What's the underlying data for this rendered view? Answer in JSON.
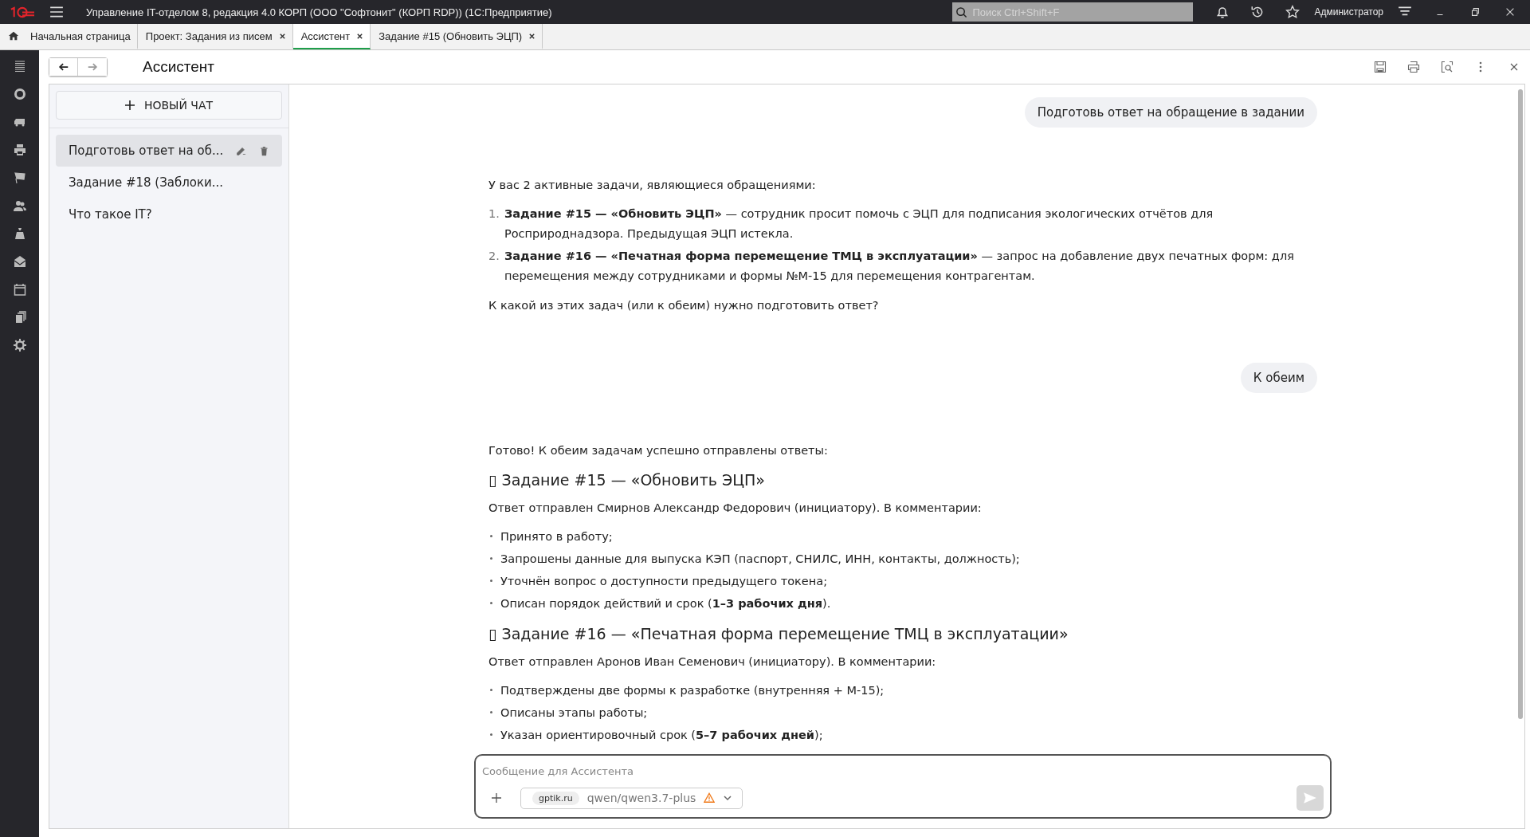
{
  "app_bar": {
    "title": "Управление IT-отделом 8, редакция 4.0 КОРП (ООО \"Софтонит\" (КОРП RDP))  (1С:Предприятие)",
    "search": {
      "placeholder": "Поиск Ctrl+Shift+F"
    },
    "user": "Администратор"
  },
  "tabs": [
    {
      "label": "Начальная страница",
      "kind": "home",
      "selected": false
    },
    {
      "label": "Проект: Задания из писем",
      "kind": "closable",
      "selected": false
    },
    {
      "label": "Ассистент",
      "kind": "closable",
      "selected": true
    },
    {
      "label": "Задание #15 (Обновить ЭЦП)",
      "kind": "closable",
      "selected": false
    }
  ],
  "page": {
    "title": "Ассистент"
  },
  "new_chat_button": "НОВЫЙ ЧАТ",
  "chats": [
    {
      "title": "Подготовь ответ на об...",
      "selected": true
    },
    {
      "title": "Задание #18 (Заблоки...",
      "selected": false
    },
    {
      "title": "Что такое IT?",
      "selected": false
    }
  ],
  "messages": [
    {
      "kind": "user",
      "text": "Подготовь ответ на обращение в задании"
    },
    {
      "kind": "assistant",
      "blocks": [
        {
          "kind": "paragraph",
          "text": "У вас 2 активные задачи, являющиеся обращениями:"
        },
        {
          "kind": "numbered",
          "items": [
            {
              "number": "1.",
              "text": "**Задание #15 — «Обновить ЭЦП»** — сотрудник просит помочь с ЭЦП для подписания экологических отчётов для Росприроднадзора. Предыдущая ЭЦП истекла."
            },
            {
              "number": "2.",
              "text": "**Задание #16 — «Печатная форма перемещение ТМЦ в эксплуатации»** — запрос на добавление двух печатных форм: для перемещения между сотрудниками и формы №М-15 для перемещения контрагентам."
            }
          ]
        },
        {
          "kind": "paragraph",
          "text": "К какой из этих задач (или к обеим) нужно подготовить ответ?"
        }
      ]
    },
    {
      "kind": "user",
      "text": "К обеим"
    },
    {
      "kind": "assistant",
      "blocks": [
        {
          "kind": "paragraph",
          "text": "Готово! К обеим задачам успешно отправлены ответы:"
        },
        {
          "kind": "heading",
          "text": "▯ Задание #15 — «Обновить ЭЦП»"
        },
        {
          "kind": "paragraph",
          "text": "Ответ отправлен Смирнов Александр Федорович (инициатору). В комментарии:"
        },
        {
          "kind": "bullets",
          "items": [
            "Принято в работу;",
            "Запрошены данные для выпуска КЭП (паспорт, СНИЛС, ИНН, контакты, должность);",
            "Уточнён вопрос о доступности предыдущего токена;",
            "Описан порядок действий и срок (**1–3 рабочих дня**)."
          ]
        },
        {
          "kind": "heading",
          "text": "▯ Задание #16 — «Печатная форма перемещение ТМЦ в эксплуатации»"
        },
        {
          "kind": "paragraph",
          "text": "Ответ отправлен Аронов Иван Семенович (инициатору). В комментарии:"
        },
        {
          "kind": "bullets",
          "items": [
            "Подтверждены две формы к разработке (внутренняя + М-15);",
            "Описаны этапы работы;",
            "Указан ориентировочный срок (**5–7 рабочих дней**);"
          ]
        }
      ]
    }
  ],
  "composer": {
    "placeholder": "Сообщение для Ассистента",
    "provider": "gptik.ru",
    "model": "qwen/qwen3.7-plus",
    "warning": true
  }
}
